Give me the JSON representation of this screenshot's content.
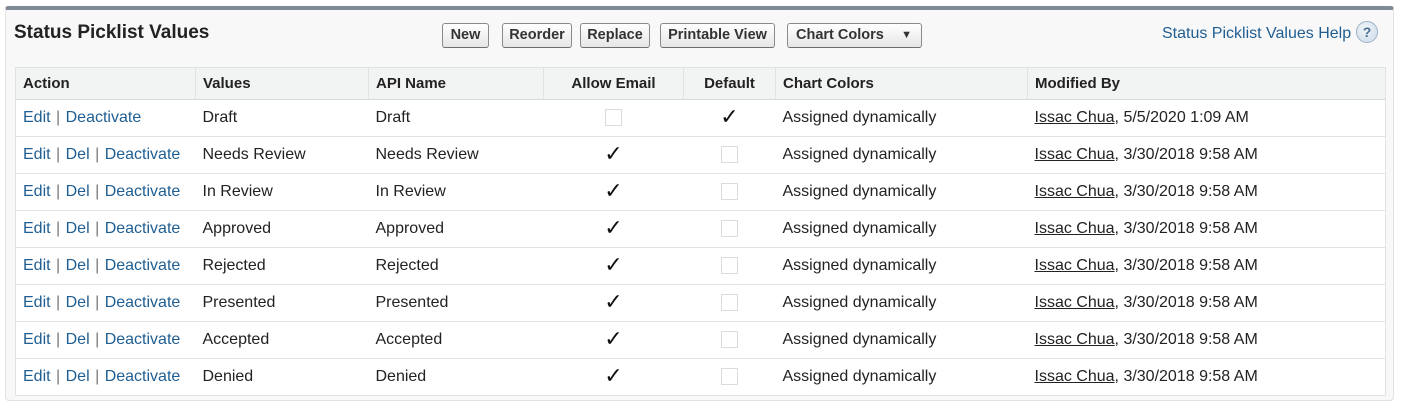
{
  "header": {
    "title": "Status Picklist Values",
    "buttons": {
      "new": "New",
      "reorder": "Reorder",
      "replace": "Replace",
      "printable_view": "Printable View",
      "chart_colors": "Chart Colors"
    },
    "help_link": "Status Picklist Values Help"
  },
  "table": {
    "columns": {
      "action": "Action",
      "values": "Values",
      "api_name": "API Name",
      "allow_email": "Allow Email",
      "default": "Default",
      "chart_colors": "Chart Colors",
      "modified_by": "Modified By"
    },
    "action_labels": {
      "edit": "Edit",
      "del": "Del",
      "deactivate": "Deactivate"
    },
    "rows": [
      {
        "has_del": false,
        "value": "Draft",
        "api_name": "Draft",
        "allow_email": false,
        "default": true,
        "chart_colors": "Assigned dynamically",
        "modified_user": "Issac Chua",
        "modified_date": ", 5/5/2020 1:09 AM"
      },
      {
        "has_del": true,
        "value": "Needs Review",
        "api_name": "Needs Review",
        "allow_email": true,
        "default": false,
        "chart_colors": "Assigned dynamically",
        "modified_user": "Issac Chua",
        "modified_date": ", 3/30/2018 9:58 AM"
      },
      {
        "has_del": true,
        "value": "In Review",
        "api_name": "In Review",
        "allow_email": true,
        "default": false,
        "chart_colors": "Assigned dynamically",
        "modified_user": "Issac Chua",
        "modified_date": ", 3/30/2018 9:58 AM"
      },
      {
        "has_del": true,
        "value": "Approved",
        "api_name": "Approved",
        "allow_email": true,
        "default": false,
        "chart_colors": "Assigned dynamically",
        "modified_user": "Issac Chua",
        "modified_date": ", 3/30/2018 9:58 AM"
      },
      {
        "has_del": true,
        "value": "Rejected",
        "api_name": "Rejected",
        "allow_email": true,
        "default": false,
        "chart_colors": "Assigned dynamically",
        "modified_user": "Issac Chua",
        "modified_date": ", 3/30/2018 9:58 AM"
      },
      {
        "has_del": true,
        "value": "Presented",
        "api_name": "Presented",
        "allow_email": true,
        "default": false,
        "chart_colors": "Assigned dynamically",
        "modified_user": "Issac Chua",
        "modified_date": ", 3/30/2018 9:58 AM"
      },
      {
        "has_del": true,
        "value": "Accepted",
        "api_name": "Accepted",
        "allow_email": true,
        "default": false,
        "chart_colors": "Assigned dynamically",
        "modified_user": "Issac Chua",
        "modified_date": ", 3/30/2018 9:58 AM"
      },
      {
        "has_del": true,
        "value": "Denied",
        "api_name": "Denied",
        "allow_email": true,
        "default": false,
        "chart_colors": "Assigned dynamically",
        "modified_user": "Issac Chua",
        "modified_date": ", 3/30/2018 9:58 AM"
      }
    ]
  }
}
